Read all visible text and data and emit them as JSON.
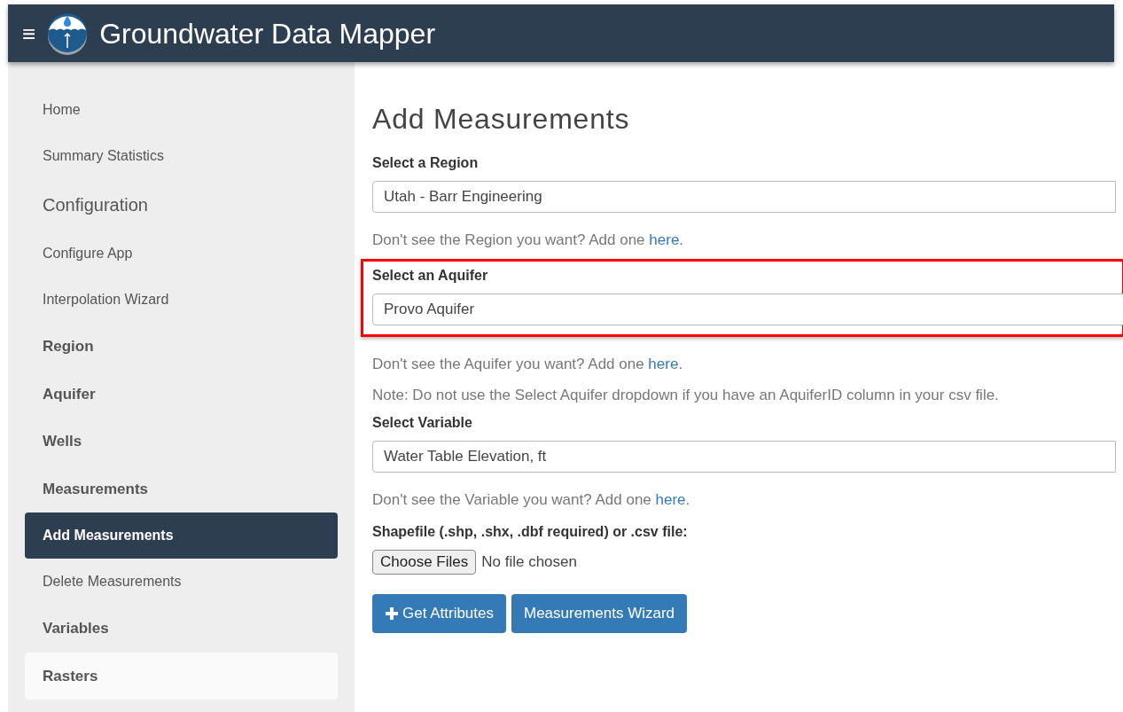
{
  "header": {
    "title": "Groundwater Data Mapper",
    "menu_icon": "≡"
  },
  "sidebar": {
    "items": [
      {
        "label": "Home",
        "kind": "link",
        "selected": false,
        "hovered": false
      },
      {
        "label": "Summary Statistics",
        "kind": "link",
        "selected": false,
        "hovered": false
      },
      {
        "label": "Configuration",
        "kind": "heading",
        "selected": false,
        "hovered": false
      },
      {
        "label": "Configure App",
        "kind": "link",
        "selected": false,
        "hovered": false
      },
      {
        "label": "Interpolation Wizard",
        "kind": "link",
        "selected": false,
        "hovered": false
      },
      {
        "label": "Region",
        "kind": "section",
        "selected": false,
        "hovered": false
      },
      {
        "label": "Aquifer",
        "kind": "section",
        "selected": false,
        "hovered": false
      },
      {
        "label": "Wells",
        "kind": "section",
        "selected": false,
        "hovered": false
      },
      {
        "label": "Measurements",
        "kind": "section",
        "selected": false,
        "hovered": false
      },
      {
        "label": "Add Measurements",
        "kind": "link",
        "selected": true,
        "hovered": false
      },
      {
        "label": "Delete Measurements",
        "kind": "link",
        "selected": false,
        "hovered": false
      },
      {
        "label": "Variables",
        "kind": "section",
        "selected": false,
        "hovered": false
      },
      {
        "label": "Rasters",
        "kind": "section",
        "selected": false,
        "hovered": true
      }
    ]
  },
  "content": {
    "title": "Add Measurements",
    "blocks": [
      {
        "kind": "select",
        "label": "Select a Region",
        "value": "Utah - Barr Engineering",
        "highlighted": false
      },
      {
        "kind": "help",
        "before": "Don't see the Region you want? Add one ",
        "link": "here",
        "after": "."
      },
      {
        "kind": "select",
        "label": "Select an Aquifer",
        "value": "Provo Aquifer",
        "highlighted": true
      },
      {
        "kind": "help",
        "before": "Don't see the Aquifer you want? Add one ",
        "link": "here",
        "after": "."
      },
      {
        "kind": "note",
        "text": "Note: Do not use the Select Aquifer dropdown if you have an AquiferID column in your csv file."
      },
      {
        "kind": "select",
        "label": "Select Variable",
        "value": "Water Table Elevation, ft",
        "highlighted": false
      },
      {
        "kind": "help",
        "before": "Don't see the Variable you want? Add one ",
        "link": "here",
        "after": "."
      },
      {
        "kind": "file",
        "label": "Shapefile (.shp, .shx, .dbf required) or .csv file:",
        "button": "Choose Files",
        "status": "No file chosen"
      },
      {
        "kind": "buttons",
        "buttons": [
          {
            "label": "Get Attributes",
            "kind": "add"
          },
          {
            "label": "Measurements Wizard",
            "kind": "plain"
          }
        ]
      }
    ]
  }
}
